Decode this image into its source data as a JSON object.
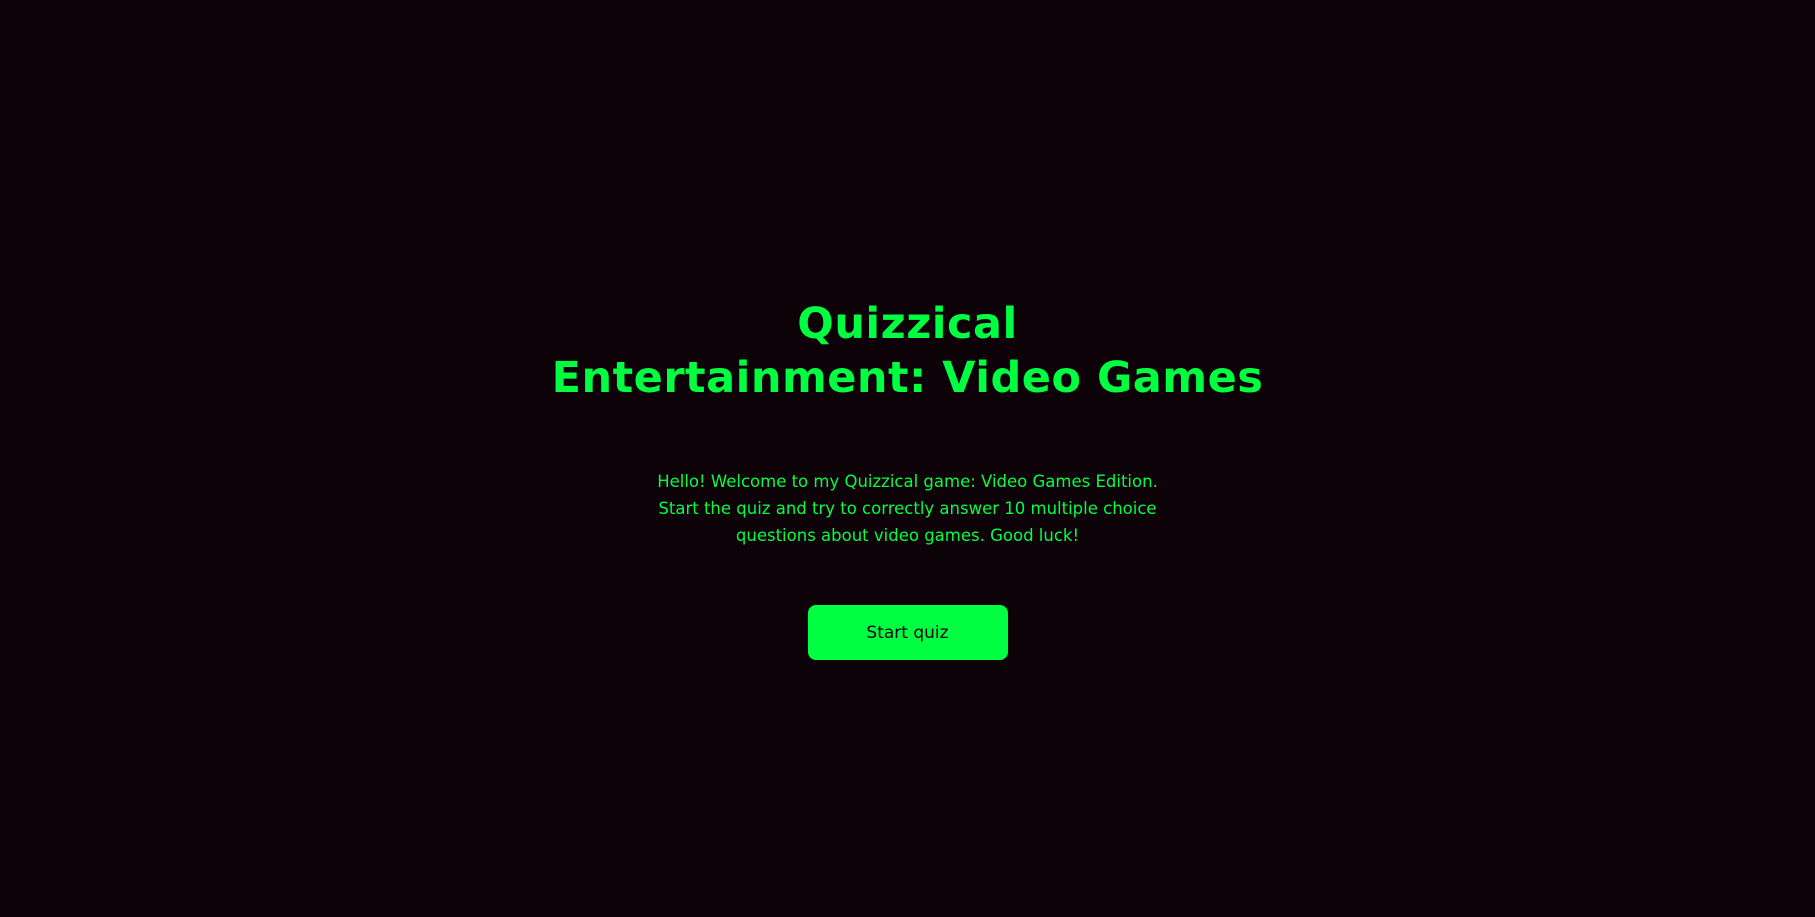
{
  "colors": {
    "background": "#0d0208",
    "accent": "#00ff41",
    "button_text": "#0d0208"
  },
  "intro": {
    "title_line1": "Quizzical",
    "title_line2": "Entertainment: Video Games",
    "description_line1": "Hello! Welcome to my Quizzical game: Video Games Edition.",
    "description_line2": "Start the quiz and try to correctly answer 10 multiple choice",
    "description_line3": "questions about video games. Good luck!",
    "start_button_label": "Start quiz"
  }
}
